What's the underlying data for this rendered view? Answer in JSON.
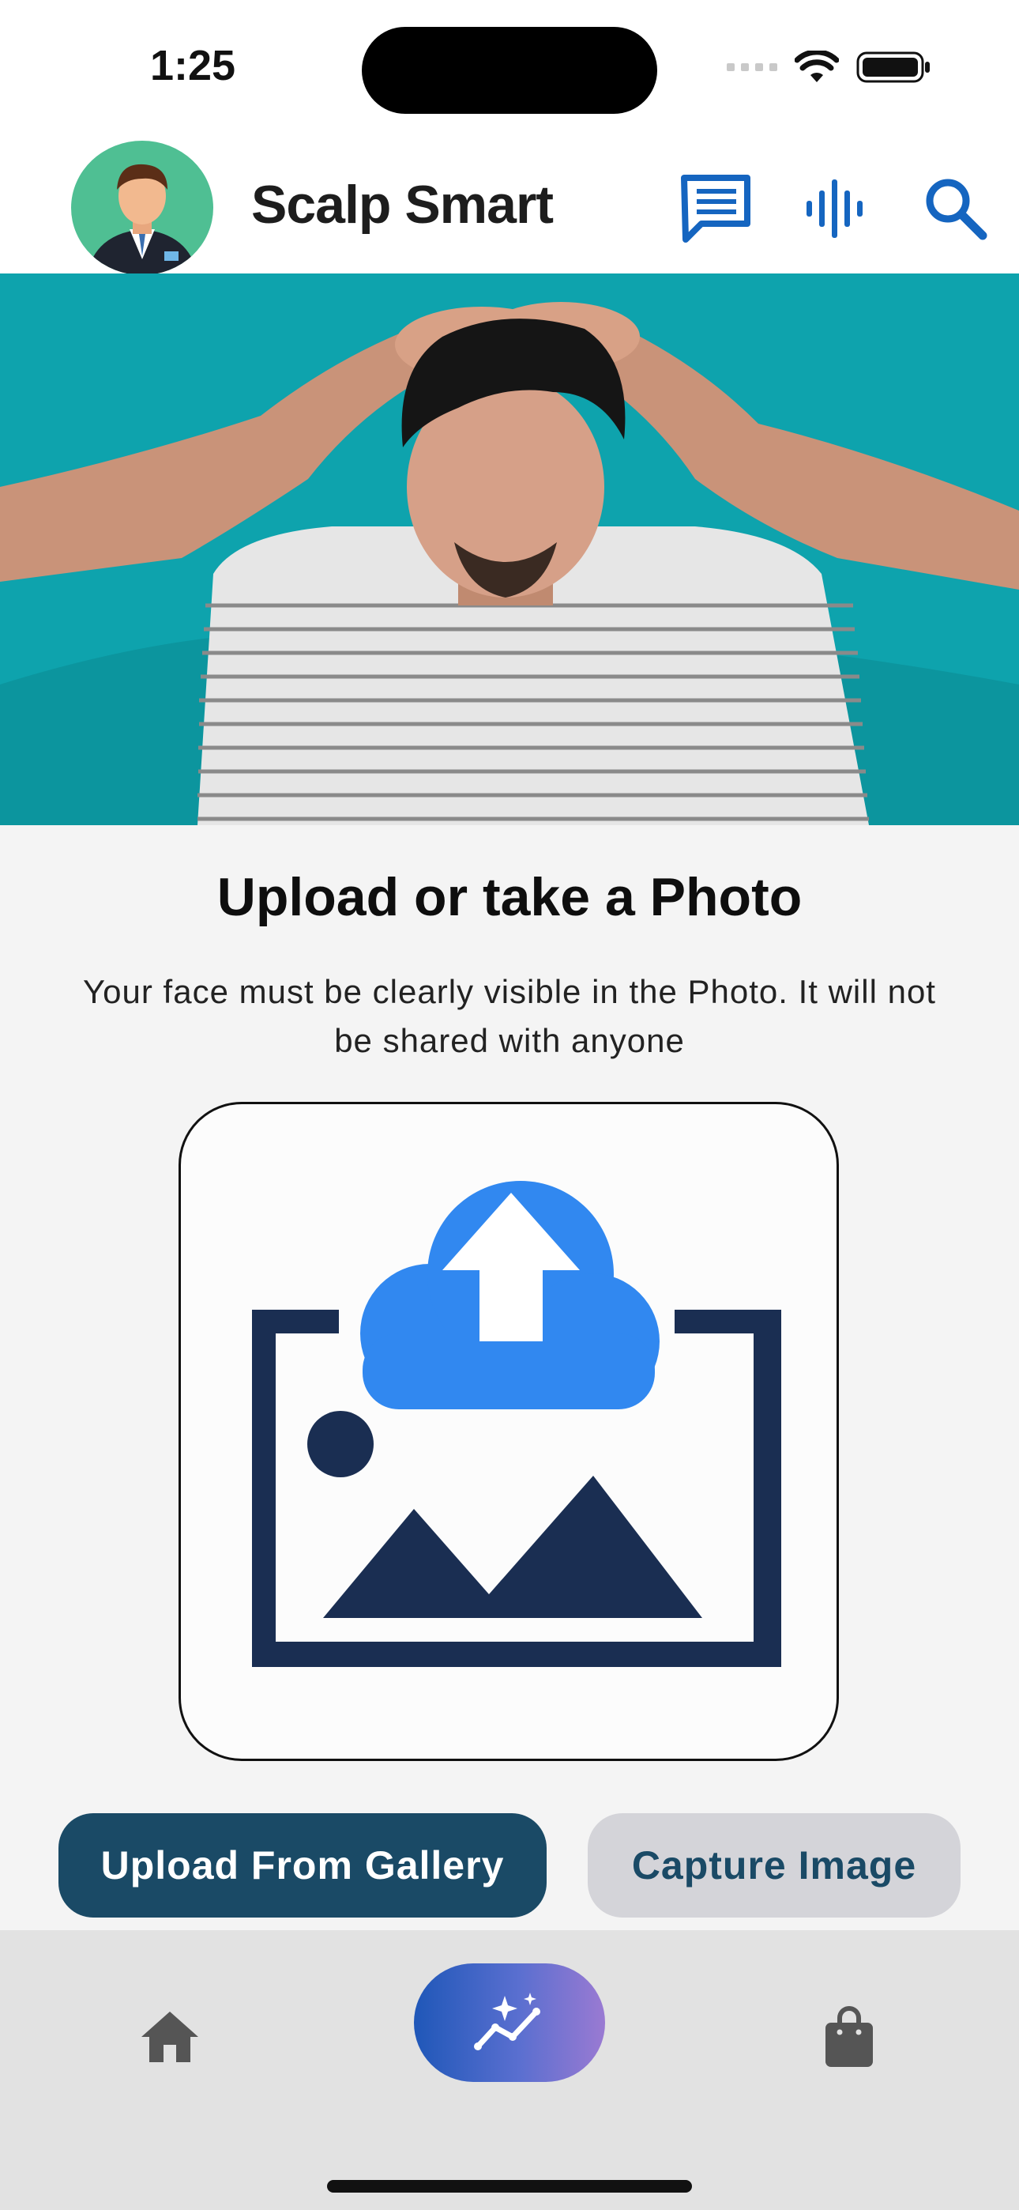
{
  "status_bar": {
    "time": "1:25"
  },
  "header": {
    "title": "Scalp Smart",
    "icons": [
      "chat-icon",
      "voice-icon",
      "search-icon"
    ],
    "avatar_bg": "#4fbf93",
    "icon_color": "#1565c0"
  },
  "hero": {
    "background": "#0ea3ad"
  },
  "upload": {
    "title": "Upload or take a Photo",
    "subtitle": "Your face must be clearly visible in the Photo. It will not be shared with anyone",
    "illustration_colors": {
      "frame": "#1a2e52",
      "cloud": "#3188f0"
    }
  },
  "buttons": {
    "gallery": "Upload From Gallery",
    "capture": "Capture Image"
  },
  "nav": {
    "items": [
      "home-icon",
      "analysis-icon",
      "shopping-bag-icon"
    ],
    "active": "analysis-icon"
  },
  "colors": {
    "primary": "#1a4a66",
    "secondary_button": "#d4d4d9"
  }
}
